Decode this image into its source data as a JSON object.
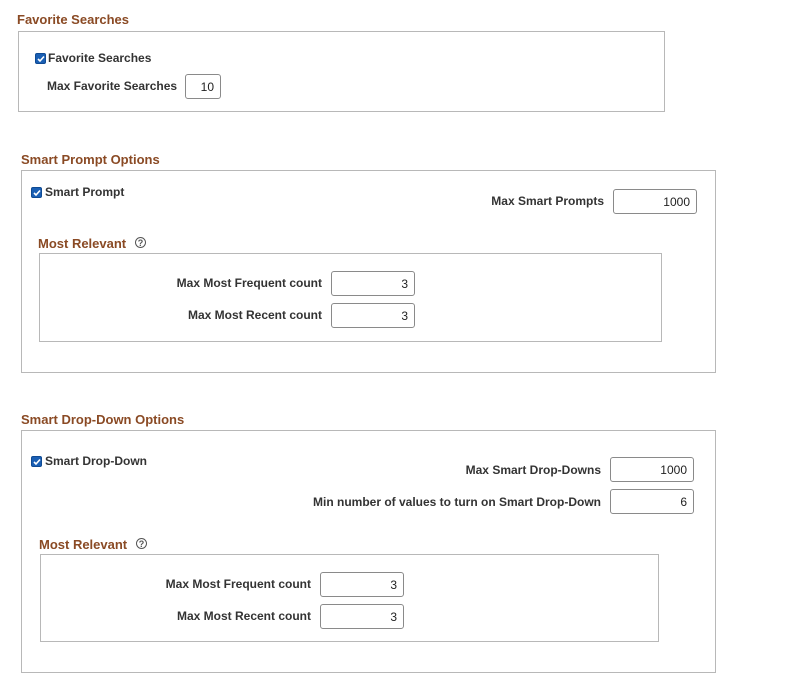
{
  "favorite_searches": {
    "title": "Favorite Searches",
    "checkbox_label": "Favorite Searches",
    "checked": true,
    "max_label": "Max Favorite Searches",
    "max_value": "10"
  },
  "smart_prompt": {
    "title": "Smart Prompt Options",
    "checkbox_label": "Smart Prompt",
    "checked": true,
    "max_label": "Max Smart Prompts",
    "max_value": "1000",
    "most_relevant": {
      "title": "Most Relevant",
      "frequent_label": "Max Most Frequent count",
      "frequent_value": "3",
      "recent_label": "Max Most Recent count",
      "recent_value": "3"
    }
  },
  "smart_dropdown": {
    "title": "Smart Drop-Down Options",
    "checkbox_label": "Smart Drop-Down",
    "checked": true,
    "max_label": "Max Smart Drop-Downs",
    "max_value": "1000",
    "min_label": "Min number of values to turn on Smart Drop-Down",
    "min_value": "6",
    "most_relevant": {
      "title": "Most Relevant",
      "frequent_label": "Max Most Frequent count",
      "frequent_value": "3",
      "recent_label": "Max Most Recent count",
      "recent_value": "3"
    }
  },
  "icons": {
    "checkbox": "checkmark-icon",
    "help": "question-circle-icon"
  },
  "colors": {
    "section_title": "#8a4a24",
    "checkbox": "#1a5fb4",
    "border": "#b8b8b8"
  }
}
